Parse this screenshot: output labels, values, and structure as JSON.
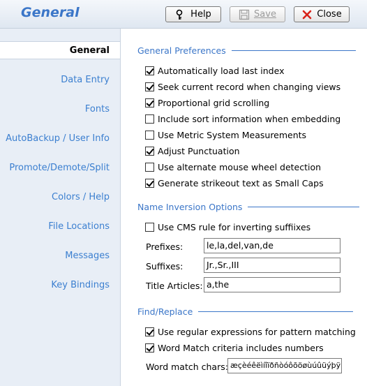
{
  "header": {
    "title": "General",
    "help_label": "Help",
    "save_label": "Save",
    "close_label": "Close"
  },
  "sidebar": {
    "items": [
      {
        "label": "General",
        "active": true
      },
      {
        "label": "Data Entry"
      },
      {
        "label": "Fonts"
      },
      {
        "label": "AutoBackup / User Info"
      },
      {
        "label": "Promote/Demote/Split"
      },
      {
        "label": "Colors / Help"
      },
      {
        "label": "File Locations"
      },
      {
        "label": "Messages"
      },
      {
        "label": "Key Bindings"
      }
    ]
  },
  "general_preferences": {
    "heading": "General Preferences",
    "options": [
      {
        "label": "Automatically load last index",
        "checked": true
      },
      {
        "label": "Seek current record when changing views",
        "checked": true
      },
      {
        "label": "Proportional grid scrolling",
        "checked": true
      },
      {
        "label": "Include sort information when embedding",
        "checked": false
      },
      {
        "label": "Use Metric System Measurements",
        "checked": false
      },
      {
        "label": "Adjust Punctuation",
        "checked": true
      },
      {
        "label": "Use alternate mouse wheel detection",
        "checked": false
      },
      {
        "label": "Generate strikeout text as Small Caps",
        "checked": true
      }
    ]
  },
  "name_inversion": {
    "heading": "Name Inversion Options",
    "cms_rule": {
      "label": "Use CMS rule for inverting suffiixes",
      "checked": false
    },
    "prefixes_label": "Prefixes:",
    "prefixes_value": "le,la,del,van,de",
    "suffixes_label": "Suffixes:",
    "suffixes_value": "Jr.,Sr.,III",
    "title_articles_label": "Title Articles:",
    "title_articles_value": "a,the"
  },
  "find_replace": {
    "heading": "Find/Replace",
    "regex": {
      "label": "Use regular expressions for pattern matching",
      "checked": true
    },
    "word_match": {
      "label": "Word Match criteria includes numbers",
      "checked": true
    },
    "word_chars_label": "Word match chars:",
    "word_chars_value": "æçèéêëìíîïðñòóôõöøùúûüýþÿ"
  },
  "colors": {
    "accent": "#3b76c8",
    "sidebar_bg": "#e8eef6"
  }
}
